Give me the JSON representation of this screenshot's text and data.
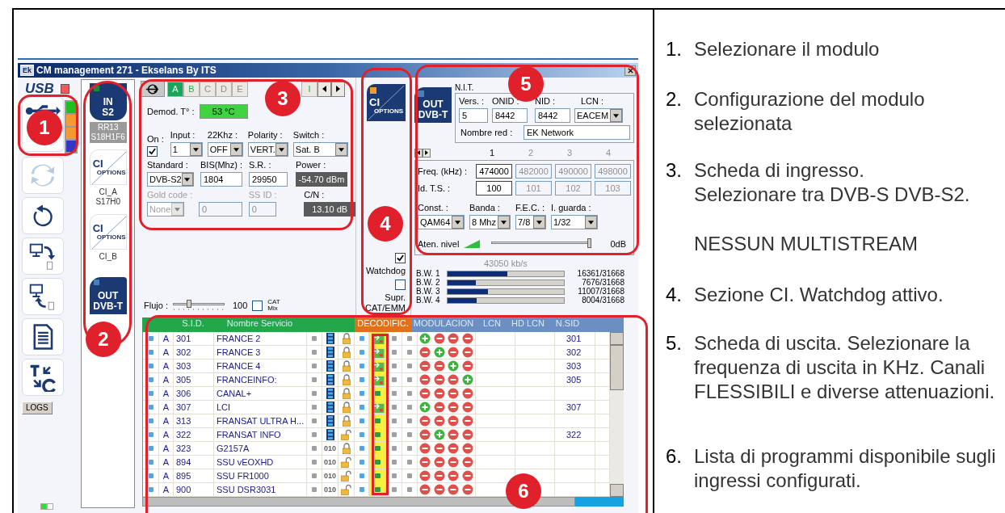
{
  "window": {
    "icon_label": "Ek",
    "title": "CM management 271 - Ekselans By ITS"
  },
  "toolbar": {
    "usb_label": "USB",
    "slots": [
      {
        "color": "#1fbf1f"
      },
      {
        "color": "#f59a2f"
      },
      {
        "color": "#f59a2f"
      },
      {
        "color": "#3535c8"
      }
    ],
    "logs_button": "LOGS"
  },
  "modules": [
    {
      "kind": "in",
      "title": "IN",
      "subtitle": "S2",
      "caption": [
        "RR13",
        "S18H1F6"
      ]
    },
    {
      "kind": "ci",
      "title": "CI",
      "subtitle": "OPTIONS",
      "caption": [
        "CI_A",
        "S17H0"
      ]
    },
    {
      "kind": "ci",
      "title": "CI",
      "subtitle": "OPTIONS",
      "caption": [
        "CI_B"
      ]
    },
    {
      "kind": "out",
      "title": "OUT",
      "subtitle": "DVB-T"
    }
  ],
  "input_panel": {
    "tabs": [
      {
        "label": "A",
        "selected": true,
        "disabled": false
      },
      {
        "label": "B",
        "selected": false,
        "disabled": false
      },
      {
        "label": "C",
        "selected": false,
        "disabled": true
      },
      {
        "label": "D",
        "selected": false,
        "disabled": true
      },
      {
        "label": "E",
        "selected": false,
        "disabled": true
      },
      {
        "label": "I",
        "selected": false,
        "disabled": false
      }
    ],
    "demod": {
      "label": "Demod. T° :",
      "value": "53 °C"
    },
    "on": {
      "label": "On :",
      "checked": true
    },
    "input": {
      "label": "Input :",
      "value": "1"
    },
    "khz": {
      "label": "22Khz :",
      "value": "OFF"
    },
    "polarity": {
      "label": "Polarity :",
      "value": "VERT."
    },
    "switch": {
      "label": "Switch :",
      "value": "Sat. B"
    },
    "standard": {
      "label": "Standard :",
      "value": "DVB-S2"
    },
    "bis": {
      "label": "BIS(Mhz) :",
      "value": "1804"
    },
    "sr": {
      "label": "S.R. :",
      "value": "29950"
    },
    "power": {
      "label": "Power :",
      "value": "-54.70 dBm"
    },
    "gold_code": {
      "label": "Gold code :",
      "value": "None",
      "value_2": "0",
      "disabled": true
    },
    "ss_id": {
      "label": "SS ID :",
      "value": "0",
      "disabled": true
    },
    "cn": {
      "label": "C/N :",
      "value": "13.10 dB"
    },
    "flow": {
      "label": "Flujo :",
      "level": 0.3,
      "value": "100"
    },
    "cat_mix": {
      "label": "CAT Mix",
      "checked": false
    }
  },
  "ci_panel": {
    "title": "CI",
    "subtitle": "OPTIONS",
    "watchdog": {
      "label": "Watchdog",
      "checked": true
    },
    "suppress": {
      "label": "Supr. CAT/EMM",
      "checked": false
    }
  },
  "output_panel": {
    "title": "OUT",
    "subtitle": "DVB-T",
    "nit": {
      "label": "N.I.T.",
      "version": {
        "label": "Vers. :",
        "value": "5"
      },
      "onid": {
        "label": "ONID :",
        "value": "8442"
      },
      "nid": {
        "label": "NID :",
        "value": "8442"
      },
      "lcn": {
        "label": "LCN :",
        "value": "EACEM"
      },
      "network_name": {
        "label": "Nombre red :",
        "value": "EK Network"
      }
    },
    "channels": [
      {
        "label": "1",
        "selected": true,
        "frequency": "474000",
        "ts_id": "100"
      },
      {
        "label": "2",
        "selected": false,
        "frequency": "482000",
        "ts_id": "101"
      },
      {
        "label": "3",
        "selected": false,
        "frequency": "490000",
        "ts_id": "102"
      },
      {
        "label": "4",
        "selected": false,
        "frequency": "498000",
        "ts_id": "103"
      }
    ],
    "freq_label": "Freq. (kHz) :",
    "ts_label": "Id. T.S. :",
    "const": {
      "label": "Const. :",
      "value": "QAM64"
    },
    "band": {
      "label": "Banda :",
      "value": "8 Mhz"
    },
    "fec": {
      "label": "F.E.C. :",
      "value": "7/8"
    },
    "guard": {
      "label": "I. guarda :",
      "value": "1/32"
    },
    "attenuation": {
      "label": "Aten. nivel",
      "level": 1.0,
      "value": "0dB"
    },
    "bitrate": "43050 kb/s",
    "bandwidth": [
      {
        "label": "B.W. 1",
        "level": 0.517,
        "reading": "16361/31668"
      },
      {
        "label": "B.W. 2",
        "level": 0.242,
        "reading": "7676/31668"
      },
      {
        "label": "B.W. 3",
        "level": 0.348,
        "reading": "11007/31668"
      },
      {
        "label": "B.W. 4",
        "level": 0.253,
        "reading": "8004/31668"
      }
    ]
  },
  "table": {
    "columns": {
      "sid": "S.I.D.",
      "name": "Nombre Servicio",
      "decoding": "DECODIFIC.",
      "modulation": "MODULACION",
      "lcn": "LCN",
      "hd_lcn": "HD LCN",
      "nsid": "N.SID"
    },
    "rows": [
      {
        "band": "A",
        "sid": "301",
        "name": "FRANCE 2",
        "kind": "video",
        "scrambled": true,
        "descrambling": true,
        "modulation": [
          true,
          false,
          false,
          false
        ],
        "nsid": "301"
      },
      {
        "band": "A",
        "sid": "302",
        "name": "FRANCE 3",
        "kind": "video",
        "scrambled": true,
        "descrambling": true,
        "modulation": [
          false,
          true,
          false,
          false
        ],
        "nsid": "302"
      },
      {
        "band": "A",
        "sid": "303",
        "name": "FRANCE 4",
        "kind": "video",
        "scrambled": true,
        "descrambling": true,
        "modulation": [
          false,
          false,
          true,
          false
        ],
        "nsid": "303"
      },
      {
        "band": "A",
        "sid": "305",
        "name": "FRANCEINFO:",
        "kind": "video",
        "scrambled": true,
        "descrambling": true,
        "modulation": [
          false,
          false,
          false,
          true
        ],
        "nsid": "305"
      },
      {
        "band": "A",
        "sid": "306",
        "name": "CANAL+",
        "kind": "video",
        "scrambled": true,
        "descrambling": false,
        "modulation": [
          false,
          false,
          false,
          false
        ]
      },
      {
        "band": "A",
        "sid": "307",
        "name": "LCI",
        "kind": "video",
        "scrambled": true,
        "descrambling": true,
        "modulation": [
          true,
          false,
          false,
          false
        ],
        "nsid": "307"
      },
      {
        "band": "A",
        "sid": "313",
        "name": "FRANSAT ULTRA H...",
        "kind": "video",
        "scrambled": true,
        "descrambling": false,
        "modulation": [
          false,
          false,
          false,
          false
        ]
      },
      {
        "band": "A",
        "sid": "322",
        "name": "FRANSAT INFO",
        "kind": "video",
        "scrambled": false,
        "descrambling": false,
        "modulation": [
          false,
          true,
          false,
          false
        ],
        "nsid": "322"
      },
      {
        "band": "A",
        "sid": "323",
        "name": "G2157A",
        "kind": "data",
        "data_label": "010",
        "scrambled": true,
        "descrambling": false,
        "modulation": [
          false,
          false,
          false,
          false
        ]
      },
      {
        "band": "A",
        "sid": "894",
        "name": "SSU vEOXHD",
        "kind": "data",
        "data_label": "010",
        "scrambled": false,
        "descrambling": false,
        "modulation": [
          false,
          false,
          false,
          false
        ]
      },
      {
        "band": "A",
        "sid": "895",
        "name": "SSU FR1000",
        "kind": "data",
        "data_label": "010",
        "scrambled": false,
        "descrambling": false,
        "modulation": [
          false,
          false,
          false,
          false
        ]
      },
      {
        "band": "A",
        "sid": "900",
        "name": "SSU DSR3031",
        "kind": "data",
        "data_label": "010",
        "scrambled": false,
        "descrambling": false,
        "modulation": [
          false,
          false,
          false,
          false
        ]
      }
    ]
  },
  "callouts": [
    {
      "number": "1"
    },
    {
      "number": "2"
    },
    {
      "number": "3"
    },
    {
      "number": "4"
    },
    {
      "number": "5"
    },
    {
      "number": "6"
    }
  ],
  "instructions": [
    {
      "number": "1.",
      "text": "Selezionare il modulo"
    },
    {
      "number": "2.",
      "text": "Configurazione del modulo selezionata"
    },
    {
      "number": "3.",
      "text": "Scheda di ingresso.",
      "text_2": "Selezionare tra DVB-S DVB-S2.",
      "note": "NESSUN MULTISTREAM"
    },
    {
      "number": "4.",
      "text": "Sezione CI. Watchdog attivo."
    },
    {
      "number": "5.",
      "text": "Scheda di uscita. Selezionare la frequenza di uscita in KHz. Canali FLESSIBILI e diverse attenuazioni."
    },
    {
      "number": "6.",
      "text": "Lista di programmi disponibile sugli ingressi configurati."
    }
  ]
}
